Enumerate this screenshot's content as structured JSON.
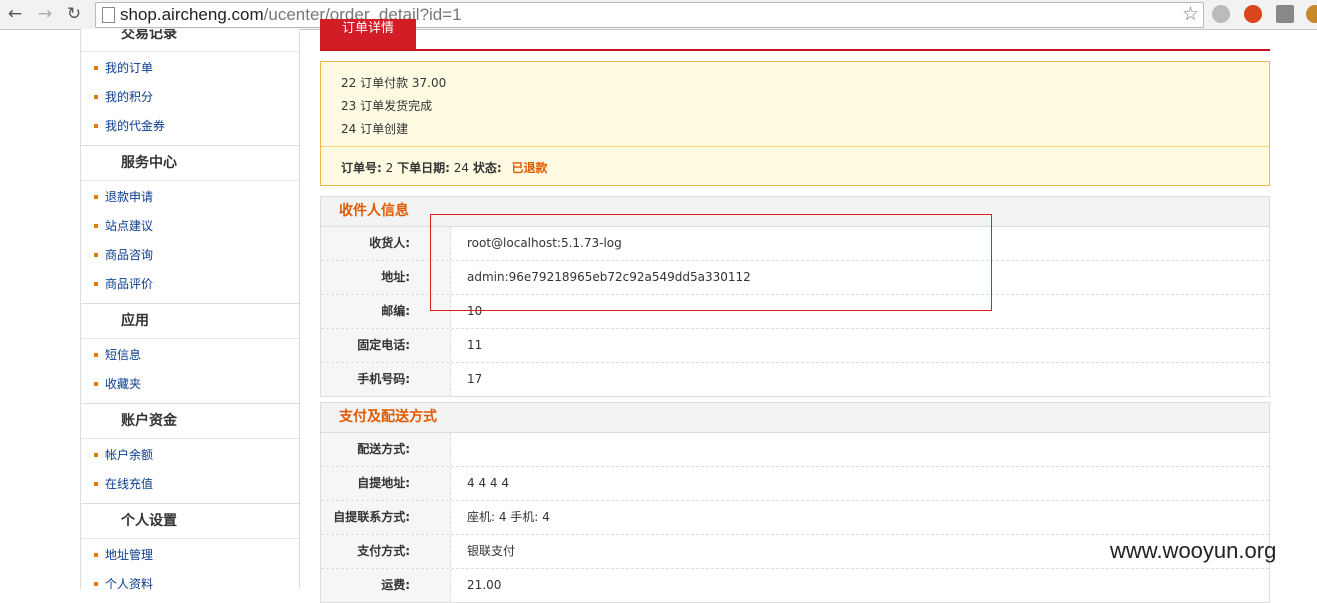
{
  "browser": {
    "url_host": "shop.aircheng.com",
    "url_path": "/ucenter/order_detail?id=1"
  },
  "sidebar": {
    "first_heading": "交易记录",
    "sections": [
      {
        "items": [
          "我的订单",
          "我的积分",
          "我的代金券"
        ]
      },
      {
        "heading": "服务中心",
        "items": [
          "退款申请",
          "站点建议",
          "商品咨询",
          "商品评价"
        ]
      },
      {
        "heading": "应用",
        "items": [
          "短信息",
          "收藏夹"
        ]
      },
      {
        "heading": "账户资金",
        "items": [
          "帐户余额",
          "在线充值"
        ]
      },
      {
        "heading": "个人设置",
        "items": [
          "地址管理",
          "个人资料"
        ]
      }
    ]
  },
  "main": {
    "tab_label": "订单详情",
    "log": [
      "22  订单付款 37.00",
      "23  订单发货完成",
      "24  订单创建"
    ],
    "order_no_label": "订单号:",
    "order_no": "2",
    "order_date_label": "下单日期:",
    "order_date": "24",
    "status_label": "状态:",
    "status": "已退款",
    "recipient": {
      "title": "收件人信息",
      "rows": [
        {
          "label": "收货人:",
          "value": "root@localhost:5.1.73-log"
        },
        {
          "label": "地址:",
          "value": "admin:96e79218965eb72c92a549dd5a330112"
        },
        {
          "label": "邮编:",
          "value": "10"
        },
        {
          "label": "固定电话:",
          "value": "11"
        },
        {
          "label": "手机号码:",
          "value": "17"
        }
      ]
    },
    "payment": {
      "title": "支付及配送方式",
      "rows": [
        {
          "label": "配送方式:",
          "value": ""
        },
        {
          "label": "自提地址:",
          "value": "4 4 4 4"
        },
        {
          "label": "自提联系方式:",
          "value": "座机: 4   手机: 4"
        },
        {
          "label": "支付方式:",
          "value": "银联支付"
        },
        {
          "label": "运费:",
          "value": "21.00"
        }
      ]
    }
  },
  "watermark": "www.wooyun.org"
}
